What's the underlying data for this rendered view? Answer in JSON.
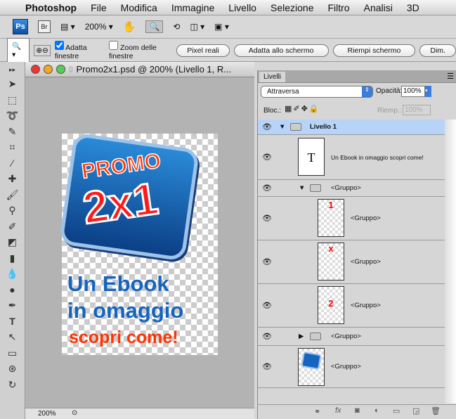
{
  "menubar": {
    "items": [
      "Photoshop",
      "File",
      "Modifica",
      "Immagine",
      "Livello",
      "Selezione",
      "Filtro",
      "Analisi",
      "3D"
    ]
  },
  "appbar": {
    "ps": "Ps",
    "br": "Br",
    "zoom": "200%"
  },
  "options": {
    "adatta": "Adatta finestre",
    "adatta_checked": true,
    "zoom_fin": "Zoom delle finestre",
    "zoom_fin_checked": false,
    "buttons": [
      "Pixel reali",
      "Adatta allo schermo",
      "Riempi schermo",
      "Dim."
    ]
  },
  "document": {
    "title": "Promo2x1.psd @ 200% (Livello 1, R...",
    "zoom": "200%",
    "art": {
      "promo": "PROMO",
      "big": "2x1",
      "line1": "Un Ebook",
      "line2": "in omaggio",
      "line3": "scopri come!"
    }
  },
  "layers": {
    "tab": "Livelli",
    "blend": "Attraversa",
    "opacity_label": "Opacità:",
    "opacity": "100%",
    "lock_label": "Bloc.:",
    "fill_label": "Riemp.:",
    "fill": "100%",
    "rows": [
      {
        "name": "Livello 1"
      },
      {
        "name": "Un Ebook in omaggio scopri come!",
        "thumb": "T"
      },
      {
        "name": "<Gruppo>"
      },
      {
        "name": "<Gruppo>",
        "thumb": "1"
      },
      {
        "name": "<Gruppo>",
        "thumb": "x"
      },
      {
        "name": "<Gruppo>",
        "thumb": "2"
      },
      {
        "name": "<Gruppo>"
      },
      {
        "name": "<Gruppo>"
      }
    ]
  },
  "colors": {
    "selected": "#b7d3f7",
    "accent": "#1565c0",
    "red": "#ff3300"
  }
}
